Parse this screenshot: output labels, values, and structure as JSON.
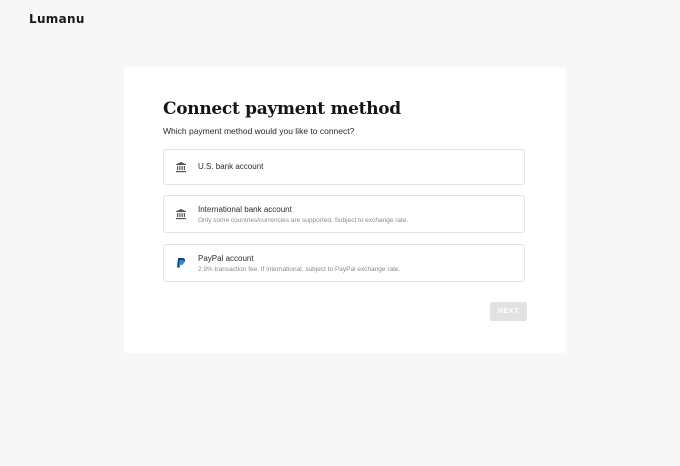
{
  "app": {
    "logo_text": "Lumanu"
  },
  "page": {
    "title": "Connect payment method",
    "subtitle": "Which payment method would you like to connect?"
  },
  "options": [
    {
      "label": "U.S. bank account",
      "description": "",
      "icon": "bank-icon"
    },
    {
      "label": "International bank account",
      "description": "Only some countries/currencies are supported. Subject to exchange rate.",
      "icon": "bank-icon"
    },
    {
      "label": "PayPal account",
      "description": "2.9% transaction fee. If international, subject to PayPal exchange rate.",
      "icon": "paypal-icon"
    }
  ],
  "actions": {
    "next_label": "NEXT",
    "next_disabled": true
  },
  "colors": {
    "background": "#f7f7f7",
    "card": "#ffffff",
    "paypal_dark": "#253b80",
    "paypal_light": "#179bd7",
    "button_disabled": "#e2e2e4"
  }
}
